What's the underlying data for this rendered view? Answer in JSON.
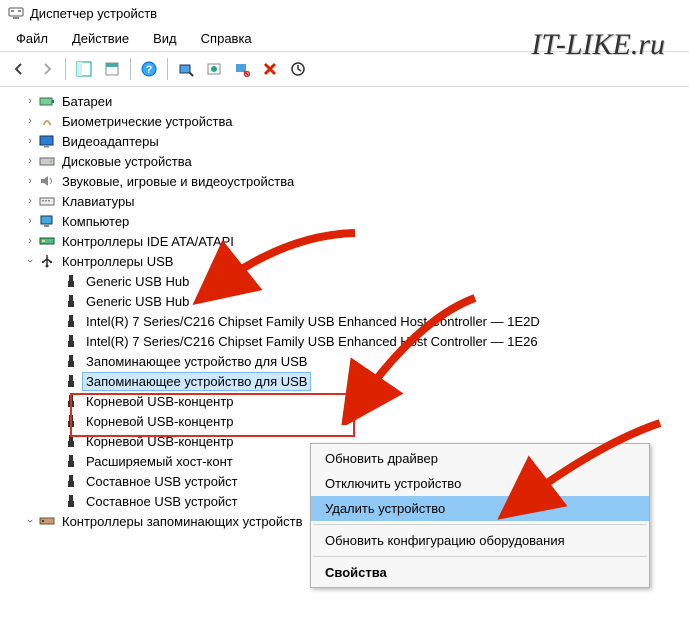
{
  "window": {
    "title": "Диспетчер устройств"
  },
  "menu": {
    "file": "Файл",
    "action": "Действие",
    "view": "Вид",
    "help": "Справка"
  },
  "watermark": "IT-LIKE.ru",
  "tree": {
    "batteries": "Батареи",
    "biometric": "Биометрические устройства",
    "display": "Видеоадаптеры",
    "disk_drives": "Дисковые устройства",
    "sound": "Звуковые, игровые и видеоустройства",
    "keyboards": "Клавиатуры",
    "computer": "Компьютер",
    "ide_ata": "Контроллеры IDE ATA/ATAPI",
    "usb_controllers": "Контроллеры USB",
    "usb_children": {
      "generic_hub_1": "Generic USB Hub",
      "generic_hub_2": "Generic USB Hub",
      "intel_1e2d": "Intel(R) 7 Series/C216 Chipset Family USB Enhanced Host Controller — 1E2D",
      "intel_1e26": "Intel(R) 7 Series/C216 Chipset Family USB Enhanced Host Controller — 1E26",
      "usb_storage_1": "Запоминающее устройство для USB",
      "usb_storage_2": "Запоминающее устройство для USB",
      "root_hub_1": "Корневой USB-концентр",
      "root_hub_2": "Корневой USB-концентр",
      "root_hub_3": "Корневой USB-концентр",
      "ext_host": "Расширяемый хост-конт",
      "composite_1": "Составное USB устройст",
      "composite_2": "Составное USB устройст"
    },
    "storage_controllers": "Контроллеры запоминающих устройств"
  },
  "context_menu": {
    "update_driver": "Обновить драйвер",
    "disable_device": "Отключить устройство",
    "uninstall_device": "Удалить устройство",
    "scan_hw": "Обновить конфигурацию оборудования",
    "properties": "Свойства"
  }
}
